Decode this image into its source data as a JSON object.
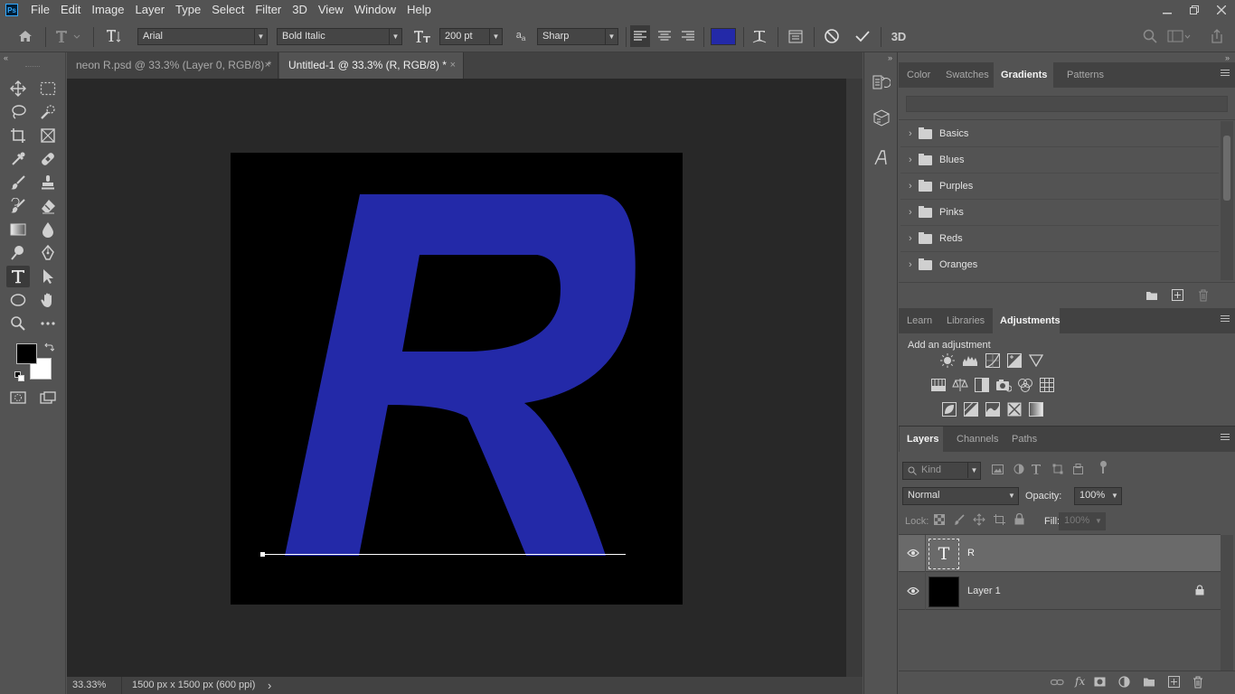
{
  "app": {
    "logo_text": "Ps",
    "menu": [
      "File",
      "Edit",
      "Image",
      "Layer",
      "Type",
      "Select",
      "Filter",
      "3D",
      "View",
      "Window",
      "Help"
    ]
  },
  "options": {
    "font_family": "Arial",
    "font_style": "Bold Italic",
    "font_size": "200 pt",
    "antialias_prefix": "a",
    "antialias_suffix": "a",
    "antialias": "Sharp",
    "text_color": "#2329a8",
    "three_d_label": "3D"
  },
  "tabs": [
    {
      "label": "neon R.psd @ 33.3% (Layer 0, RGB/8) *",
      "close": "×"
    },
    {
      "label": "Untitled-1 @ 33.3% (R, RGB/8) *",
      "close": "×"
    }
  ],
  "canvas": {
    "glyph": "R",
    "glyph_color": "#2329a8",
    "background_color": "#000000"
  },
  "status": {
    "zoom": "33.33%",
    "doc_info": "1500 px x 1500 px (600 ppi)",
    "arrow": "›"
  },
  "panels": {
    "top_tabs": [
      "Color",
      "Swatches",
      "Gradients",
      "Patterns"
    ],
    "gradient_folders": [
      "Basics",
      "Blues",
      "Purples",
      "Pinks",
      "Reds",
      "Oranges"
    ],
    "mid_tabs": [
      "Learn",
      "Libraries",
      "Adjustments"
    ],
    "adjust_heading": "Add an adjustment",
    "layer_tabs": [
      "Layers",
      "Channels",
      "Paths"
    ],
    "kind_placeholder": "Kind",
    "blend_mode": "Normal",
    "opacity_label": "Opacity:",
    "opacity_value": "100%",
    "lock_label": "Lock:",
    "fill_label": "Fill:",
    "fill_value": "100%",
    "fx_label": "fx",
    "layers": [
      {
        "name": "R",
        "thumb_text": "T"
      },
      {
        "name": "Layer 1"
      }
    ]
  }
}
